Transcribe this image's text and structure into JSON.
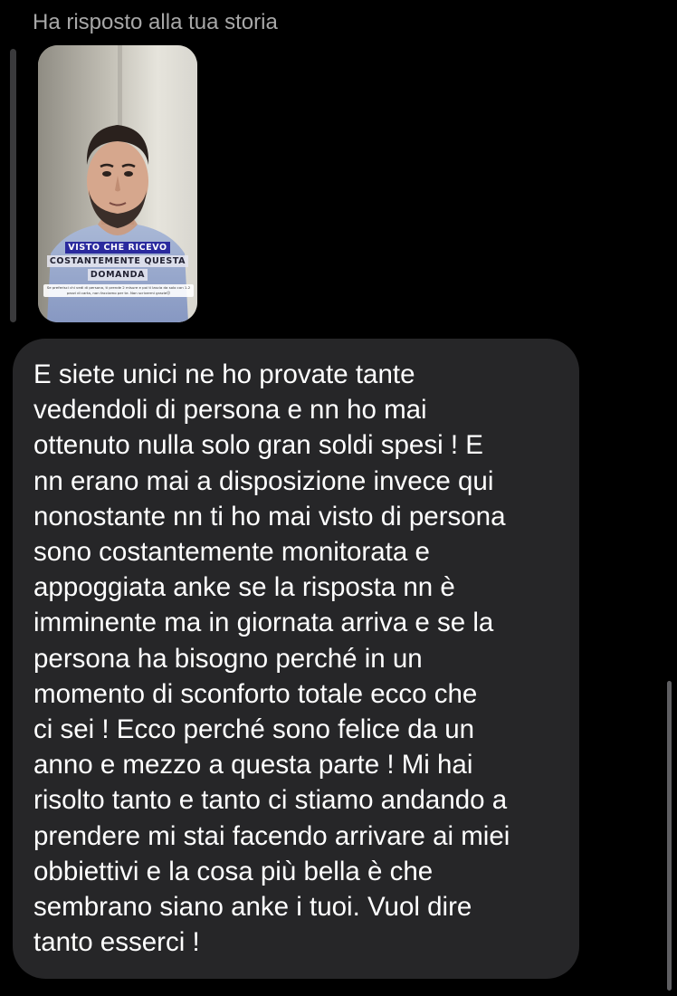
{
  "reply": {
    "header": "Ha risposto alla tua storia"
  },
  "story": {
    "caption_line1": "VISTO CHE RICEVO",
    "caption_line2": "COSTANTEMENTE QUESTA",
    "caption_line3": "DOMANDA",
    "small_caption": "Se preferisci chi vedi di persona, ti prende 2 misure e poi ti lascia da solo con 1-2 pezzi di carta, non facciamo per te. Non scrivermi grazie😉"
  },
  "message": {
    "text": "E siete unici ne ho provate tante\nvedendoli di persona e nn ho mai\nottenuto nulla solo gran soldi spesi ! E\nnn erano mai a disposizione invece qui\nnonostante nn ti ho mai visto di persona\nsono costantemente monitorata e\nappoggiata anke se la risposta nn è\nimminente ma in giornata arriva e se la\npersona ha bisogno perché in un\nmomento di sconforto totale ecco che\nci sei ! Ecco perché sono felice da un\nanno e mezzo a questa parte ! Mi hai\nrisolto tanto e tanto ci stiamo andando a\nprendere mi stai facendo arrivare ai miei\nobbiettivi e la cosa più bella è che\nsembrano siano anke i tuoi.  Vuol dire\ntanto esserci !"
  },
  "colors": {
    "background": "#000000",
    "bubble": "#262628",
    "header_text": "#a8a8a8",
    "caption_highlight": "#2a2a9e"
  }
}
